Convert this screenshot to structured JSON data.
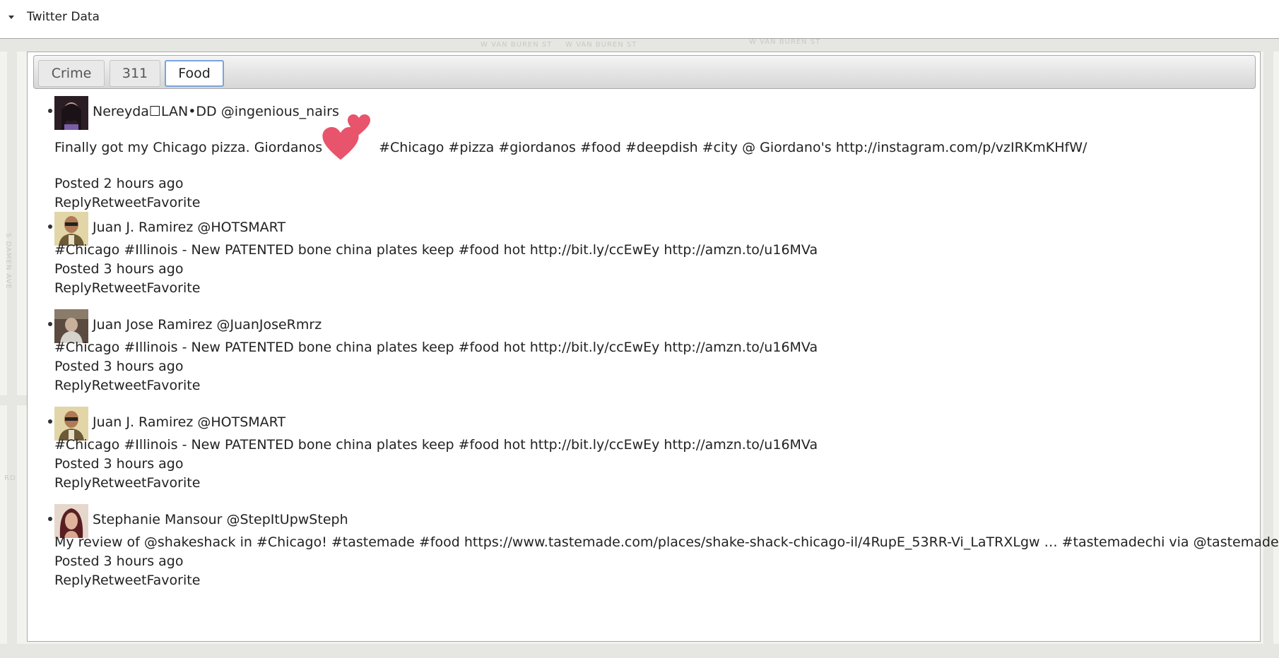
{
  "header": {
    "title": "Twitter Data"
  },
  "tabs": [
    {
      "label": "Crime",
      "active": false
    },
    {
      "label": "311",
      "active": false
    },
    {
      "label": "Food",
      "active": true
    }
  ],
  "tweets": [
    {
      "user": "Nereyda☐LAN•DD @ingenious_nairs",
      "text_before": "Finally got my Chicago pizza. Giordanos",
      "text_after": "#Chicago #pizza #giordanos #food #deepdish #city @ Giordano's http://instagram.com/p/vzIRKmKHfW/",
      "posted": "Posted 2 hours ago",
      "actions": [
        "Reply",
        "Retweet",
        "Favorite"
      ],
      "avatar_color": "#3a2a2f"
    },
    {
      "user": "Juan J. Ramirez @HOTSMART",
      "text": "#Chicago #Illinois - New PATENTED bone china plates keep #food hot http://bit.ly/ccEwEy  http://amzn.to/u16MVa",
      "posted": "Posted 3 hours ago",
      "actions": [
        "Reply",
        "Retweet",
        "Favorite"
      ],
      "avatar_color": "#c9b88a"
    },
    {
      "user": "Juan Jose Ramirez @JuanJoseRmrz",
      "text": "#Chicago #Illinois - New PATENTED bone china plates keep #food hot http://bit.ly/ccEwEy  http://amzn.to/u16MVa",
      "posted": "Posted 3 hours ago",
      "actions": [
        "Reply",
        "Retweet",
        "Favorite"
      ],
      "avatar_color": "#6f5d4f"
    },
    {
      "user": "Juan J. Ramirez @HOTSMART",
      "text": "#Chicago #Illinois - New PATENTED bone china plates keep #food hot http://bit.ly/ccEwEy  http://amzn.to/u16MVa",
      "posted": "Posted 3 hours ago",
      "actions": [
        "Reply",
        "Retweet",
        "Favorite"
      ],
      "avatar_color": "#c9b88a"
    },
    {
      "user": "Stephanie Mansour @StepItUpwSteph",
      "text": "My review of @shakeshack in #Chicago! #tastemade #food https://www.tastemade.com/places/shake-shack-chicago-il/4RupE_53RR-Vi_LaTRXLgw … #tastemadechi via @tastemade",
      "posted": "Posted 3 hours ago",
      "actions": [
        "Reply",
        "Retweet",
        "Favorite"
      ],
      "avatar_color": "#8a3b44"
    }
  ],
  "map_labels": [
    "W VAN BUREN ST",
    "W VAN BUREN ST",
    "W VAN BUREN ST",
    "S DAMEN AVE",
    "RD"
  ],
  "colors": {
    "heart": "#e8546b",
    "active_tab_border": "#7aa4de"
  }
}
